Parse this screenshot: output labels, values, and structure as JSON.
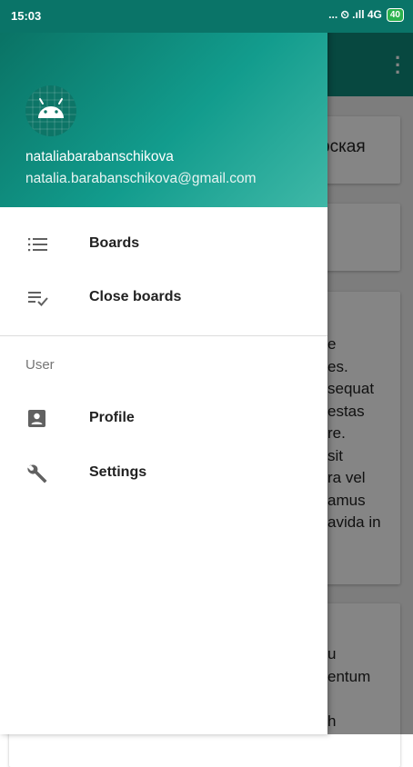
{
  "status_bar": {
    "time": "15:03",
    "indicators": "... ⏲ .ıll 4G",
    "battery": "40"
  },
  "drawer": {
    "account": {
      "name": "nataliabarabanschikova",
      "email": "natalia.barabanschikova@gmail.com",
      "avatar_icon": "android-icon"
    },
    "items": [
      {
        "label": "Boards",
        "icon": "list-icon"
      },
      {
        "label": "Close boards",
        "icon": "playlist-check-icon"
      }
    ],
    "section_title": "User",
    "user_items": [
      {
        "label": "Profile",
        "icon": "account-box-icon"
      },
      {
        "label": "Settings",
        "icon": "wrench-icon"
      }
    ]
  },
  "background": {
    "menu_icon": "more-vert-icon",
    "card1_text": "рская",
    "card3_text": "e\nes.\nsequat\nestas\nre.\nsit\nra vel\namus\navida in",
    "card4_text": "u\nentum\n\nh"
  },
  "colors": {
    "status_bar": "#0a7468",
    "toolbar": "#0f8a7b",
    "header_start": "#0a7365",
    "header_end": "#3fb8a7"
  }
}
